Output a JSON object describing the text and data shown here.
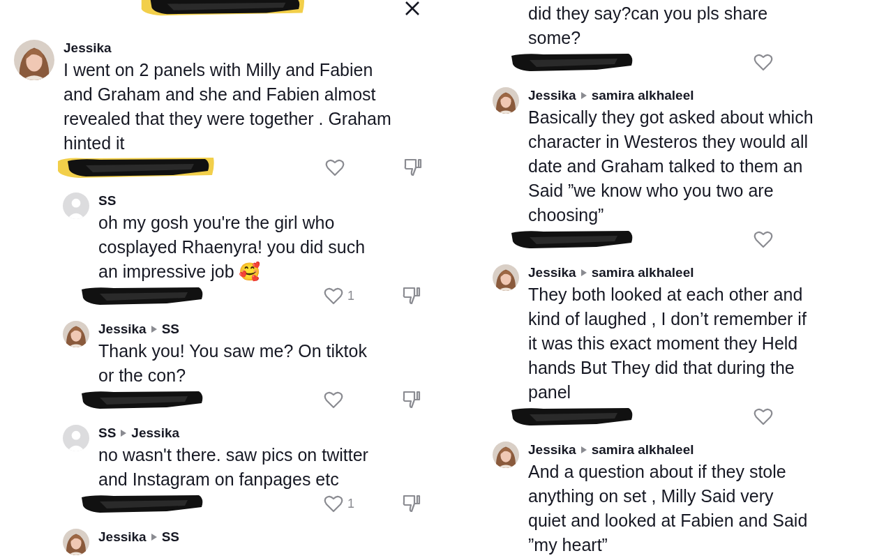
{
  "left_panel": {
    "top_redaction": {
      "highlighted": true
    },
    "comments": [
      {
        "kind": "comment",
        "author": "Jessika",
        "text": "I went on 2 panels with Milly and Fabien and Graham and she and Fabien almost revealed that they were together . Graham hinted it",
        "redaction": {
          "highlighted": true
        },
        "dislike": true
      },
      {
        "kind": "reply",
        "author": "SS",
        "avatar": {
          "kind": "default"
        },
        "text": "oh my gosh you're the girl who cosplayed Rhaenyra! you did such an impressive job 🥰",
        "redaction": {
          "highlighted": false
        },
        "likes": "1",
        "dislike": true
      },
      {
        "kind": "reply",
        "author": "Jessika",
        "reply_to": "SS",
        "text": "Thank you! You saw me? On tiktok or the con?",
        "redaction": {
          "highlighted": false
        },
        "dislike": true
      },
      {
        "kind": "reply",
        "author": "SS",
        "reply_to": "Jessika",
        "avatar": {
          "kind": "default"
        },
        "text": "no wasn't there. saw pics on twitter and Instagram on fanpages etc",
        "redaction": {
          "highlighted": false
        },
        "likes": "1",
        "dislike": true
      },
      {
        "kind": "reply",
        "author": "Jessika",
        "reply_to": "SS"
      }
    ]
  },
  "right_panel": {
    "comments": [
      {
        "kind": "reply",
        "text": "did they say?can you pls share some?",
        "redaction": {
          "highlighted": false
        },
        "dislike": false
      },
      {
        "kind": "reply",
        "author": "Jessika",
        "reply_to": "samira alkhaleel",
        "text": "Basically they got asked about which character in Westeros they would all date and Graham talked to them an Said ”we know who you two are choosing”",
        "redaction": {
          "highlighted": false
        },
        "dislike": false
      },
      {
        "kind": "reply",
        "author": "Jessika",
        "reply_to": "samira alkhaleel",
        "text": "They both looked at each other and kind of laughed , I don’t remember if it was this exact moment they Held hands But They did that during the panel",
        "redaction": {
          "highlighted": false
        },
        "dislike": false
      },
      {
        "kind": "reply",
        "author": "Jessika",
        "reply_to": "samira alkhaleel",
        "text": "And a question about if they stole anything on set , Milly Said very quiet and looked at Fabien and Said ”my heart”"
      }
    ]
  }
}
